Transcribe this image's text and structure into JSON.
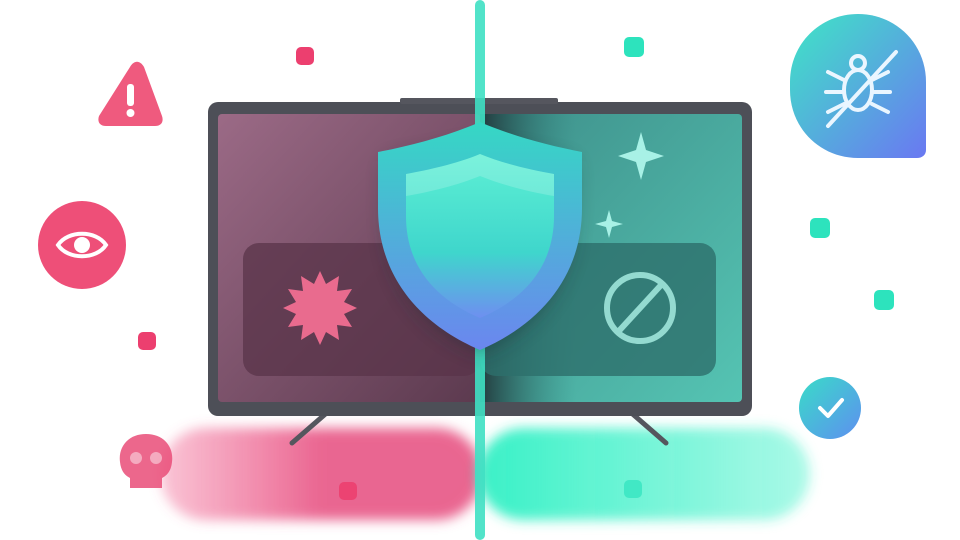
{
  "illustration": {
    "theme": "tv-security-protection",
    "icons": {
      "shield": "shield-icon",
      "warning": "warning-triangle-icon",
      "eye": "eye-icon",
      "skull": "skull-icon",
      "virus": "virus-badge-icon",
      "block": "block-icon",
      "no_bug": "no-bug-icon",
      "check": "check-icon",
      "sparkle": "sparkle-icon"
    },
    "colors": {
      "danger_pink": "#e5527a",
      "danger_dark": "#6e3f5a",
      "safe_teal": "#2fe3bf",
      "safe_dark": "#2f8f86",
      "shield_blue": "#5b8cf0",
      "tv_frame": "#4a4a52",
      "divider": "#3fe0c3"
    }
  }
}
